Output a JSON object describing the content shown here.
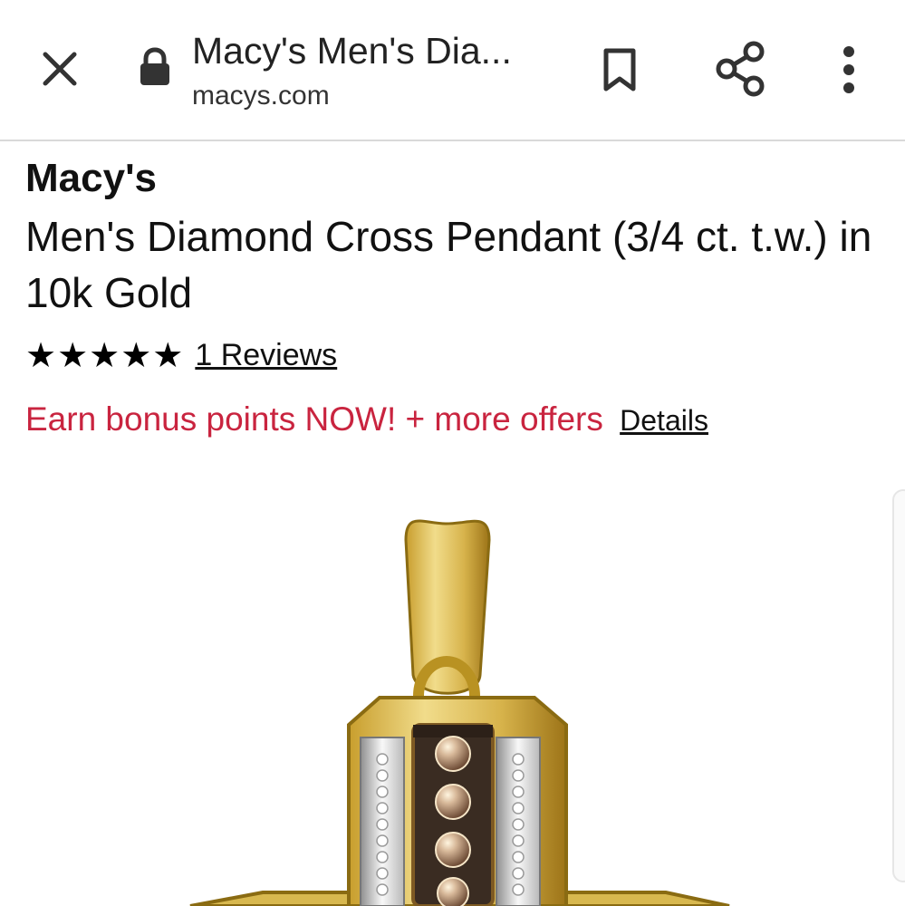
{
  "browser": {
    "title": "Macy's Men's Dia...",
    "domain": "macys.com",
    "icons": [
      "close-icon",
      "lock-icon",
      "bookmark-icon",
      "share-icon",
      "menu-icon"
    ]
  },
  "product": {
    "brand": "Macy's",
    "title": "Men's Diamond Cross Pendant (3/4 ct. t.w.) in 10k Gold",
    "stars": "★★★★★",
    "rating": 5,
    "reviews_label": "1 Reviews",
    "offer_text": "Earn bonus points NOW! + more offers",
    "details_label": "Details",
    "image_icon": "cross-pendant-image"
  },
  "colors": {
    "offer_red": "#c9243f",
    "gold": "#d8b84f",
    "dark_gold": "#8a6b12"
  }
}
